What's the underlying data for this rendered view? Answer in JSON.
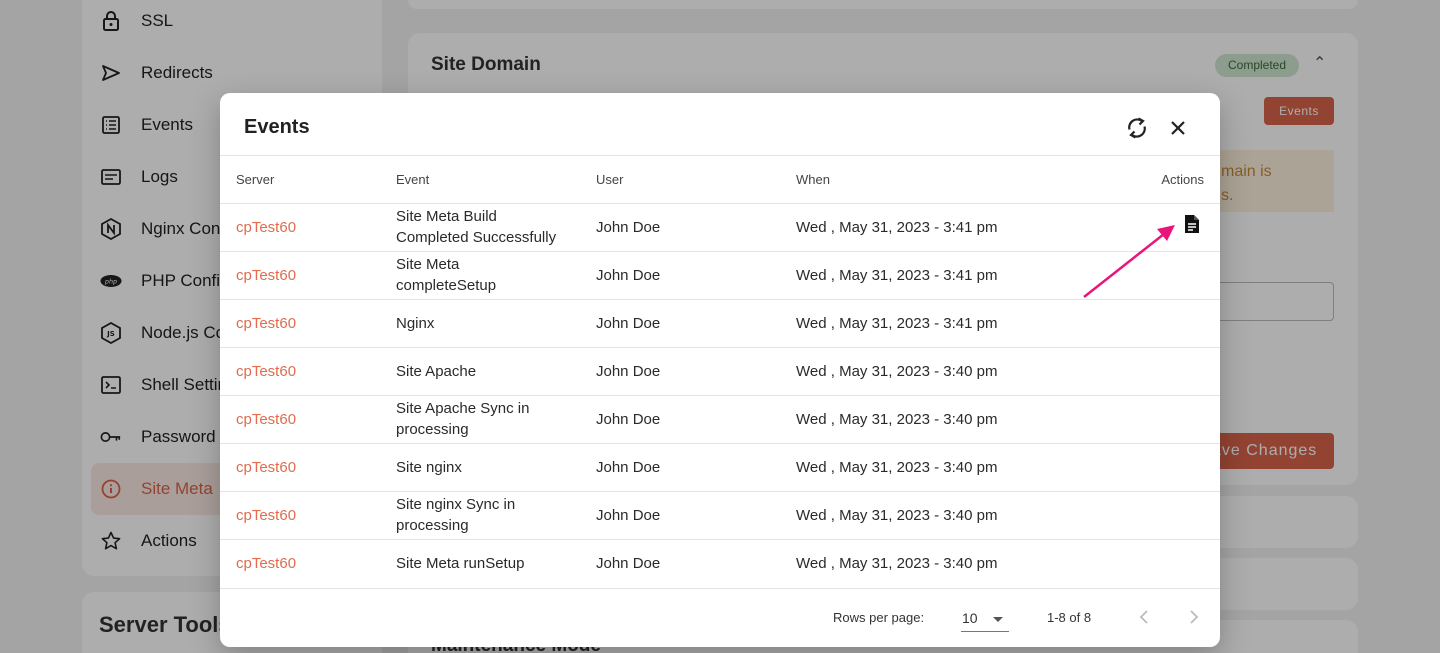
{
  "sidebar": {
    "items": [
      {
        "label": "SSL",
        "icon": "lock-icon"
      },
      {
        "label": "Redirects",
        "icon": "send-icon"
      },
      {
        "label": "Events",
        "icon": "list-icon"
      },
      {
        "label": "Logs",
        "icon": "document-lines-icon"
      },
      {
        "label": "Nginx Config",
        "icon": "nginx-icon"
      },
      {
        "label": "PHP Config",
        "icon": "php-icon"
      },
      {
        "label": "Node.js Config",
        "icon": "nodejs-icon"
      },
      {
        "label": "Shell Settings",
        "icon": "terminal-icon"
      },
      {
        "label": "Password Manager",
        "icon": "key-icon"
      },
      {
        "label": "Site Meta",
        "icon": "info-icon",
        "active": true
      },
      {
        "label": "Actions",
        "icon": "star-icon"
      }
    ],
    "tools_title": "Server Tools"
  },
  "background": {
    "domain_title": "Site Domain",
    "status_badge": "Completed",
    "events_button": "Events",
    "warning_line1": "main is",
    "warning_line2": "s.",
    "save_button": "ave Changes",
    "maintenance_title": "Maintenance Mode"
  },
  "modal": {
    "title": "Events",
    "columns": [
      "Server",
      "Event",
      "User",
      "When",
      "Actions"
    ],
    "rows": [
      {
        "server": "cpTest60",
        "event": "Site Meta Build Completed Successfully",
        "user": "John Doe",
        "when": "Wed , May 31, 2023 - 3:41 pm",
        "has_action": true
      },
      {
        "server": "cpTest60",
        "event": "Site Meta completeSetup",
        "user": "John Doe",
        "when": "Wed , May 31, 2023 - 3:41 pm"
      },
      {
        "server": "cpTest60",
        "event": "Nginx",
        "user": "John Doe",
        "when": "Wed , May 31, 2023 - 3:41 pm"
      },
      {
        "server": "cpTest60",
        "event": "Site Apache",
        "user": "John Doe",
        "when": "Wed , May 31, 2023 - 3:40 pm"
      },
      {
        "server": "cpTest60",
        "event": "Site Apache Sync in processing",
        "user": "John Doe",
        "when": "Wed , May 31, 2023 - 3:40 pm"
      },
      {
        "server": "cpTest60",
        "event": "Site nginx",
        "user": "John Doe",
        "when": "Wed , May 31, 2023 - 3:40 pm"
      },
      {
        "server": "cpTest60",
        "event": "Site nginx Sync in processing",
        "user": "John Doe",
        "when": "Wed , May 31, 2023 - 3:40 pm"
      },
      {
        "server": "cpTest60",
        "event": "Site Meta runSetup",
        "user": "John Doe",
        "when": "Wed , May 31, 2023 - 3:40 pm"
      }
    ],
    "footer": {
      "rows_per_page_label": "Rows per page:",
      "rows_per_page_value": "10",
      "range": "1-8 of 8"
    }
  },
  "colors": {
    "accent": "#d9634a",
    "server_link": "#e06c4e",
    "annotation_arrow": "#e8157a"
  }
}
